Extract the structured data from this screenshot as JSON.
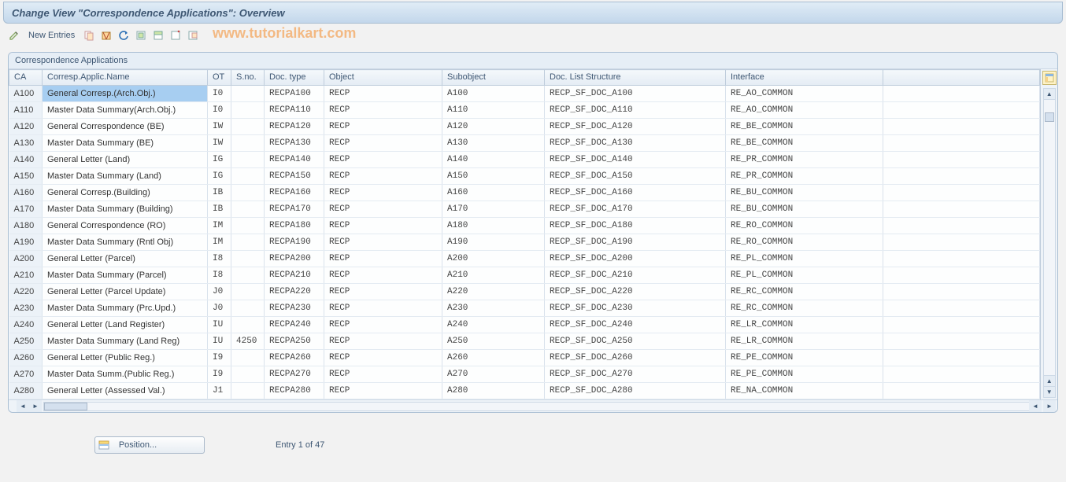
{
  "title": "Change View \"Correspondence Applications\": Overview",
  "toolbar": {
    "new_entries": "New Entries"
  },
  "watermark": "www.tutorialkart.com",
  "panel_title": "Correspondence Applications",
  "columns": {
    "ca": "CA",
    "name": "Corresp.Applic.Name",
    "ot": "OT",
    "sno": "S.no.",
    "doctype": "Doc. type",
    "object": "Object",
    "subobject": "Subobject",
    "dls": "Doc. List Structure",
    "interface": "Interface"
  },
  "rows": [
    {
      "ca": "A100",
      "name": "General Corresp.(Arch.Obj.)",
      "ot": "I0",
      "sno": "",
      "doctype": "RECPA100",
      "object": "RECP",
      "subobject": "A100",
      "dls": "RECP_SF_DOC_A100",
      "interface": "RE_AO_COMMON"
    },
    {
      "ca": "A110",
      "name": "Master Data Summary(Arch.Obj.)",
      "ot": "I0",
      "sno": "",
      "doctype": "RECPA110",
      "object": "RECP",
      "subobject": "A110",
      "dls": "RECP_SF_DOC_A110",
      "interface": "RE_AO_COMMON"
    },
    {
      "ca": "A120",
      "name": "General Correspondence (BE)",
      "ot": "IW",
      "sno": "",
      "doctype": "RECPA120",
      "object": "RECP",
      "subobject": "A120",
      "dls": "RECP_SF_DOC_A120",
      "interface": "RE_BE_COMMON"
    },
    {
      "ca": "A130",
      "name": "Master Data Summary (BE)",
      "ot": "IW",
      "sno": "",
      "doctype": "RECPA130",
      "object": "RECP",
      "subobject": "A130",
      "dls": "RECP_SF_DOC_A130",
      "interface": "RE_BE_COMMON"
    },
    {
      "ca": "A140",
      "name": "General Letter (Land)",
      "ot": "IG",
      "sno": "",
      "doctype": "RECPA140",
      "object": "RECP",
      "subobject": "A140",
      "dls": "RECP_SF_DOC_A140",
      "interface": "RE_PR_COMMON"
    },
    {
      "ca": "A150",
      "name": "Master Data Summary (Land)",
      "ot": "IG",
      "sno": "",
      "doctype": "RECPA150",
      "object": "RECP",
      "subobject": "A150",
      "dls": "RECP_SF_DOC_A150",
      "interface": "RE_PR_COMMON"
    },
    {
      "ca": "A160",
      "name": "General Corresp.(Building)",
      "ot": "IB",
      "sno": "",
      "doctype": "RECPA160",
      "object": "RECP",
      "subobject": "A160",
      "dls": "RECP_SF_DOC_A160",
      "interface": "RE_BU_COMMON"
    },
    {
      "ca": "A170",
      "name": "Master Data Summary (Building)",
      "ot": "IB",
      "sno": "",
      "doctype": "RECPA170",
      "object": "RECP",
      "subobject": "A170",
      "dls": "RECP_SF_DOC_A170",
      "interface": "RE_BU_COMMON"
    },
    {
      "ca": "A180",
      "name": "General Correspondence (RO)",
      "ot": "IM",
      "sno": "",
      "doctype": "RECPA180",
      "object": "RECP",
      "subobject": "A180",
      "dls": "RECP_SF_DOC_A180",
      "interface": "RE_RO_COMMON"
    },
    {
      "ca": "A190",
      "name": "Master Data Summary (Rntl Obj)",
      "ot": "IM",
      "sno": "",
      "doctype": "RECPA190",
      "object": "RECP",
      "subobject": "A190",
      "dls": "RECP_SF_DOC_A190",
      "interface": "RE_RO_COMMON"
    },
    {
      "ca": "A200",
      "name": "General Letter (Parcel)",
      "ot": "I8",
      "sno": "",
      "doctype": "RECPA200",
      "object": "RECP",
      "subobject": "A200",
      "dls": "RECP_SF_DOC_A200",
      "interface": "RE_PL_COMMON"
    },
    {
      "ca": "A210",
      "name": "Master Data Summary (Parcel)",
      "ot": "I8",
      "sno": "",
      "doctype": "RECPA210",
      "object": "RECP",
      "subobject": "A210",
      "dls": "RECP_SF_DOC_A210",
      "interface": "RE_PL_COMMON"
    },
    {
      "ca": "A220",
      "name": "General Letter (Parcel Update)",
      "ot": "J0",
      "sno": "",
      "doctype": "RECPA220",
      "object": "RECP",
      "subobject": "A220",
      "dls": "RECP_SF_DOC_A220",
      "interface": "RE_RC_COMMON"
    },
    {
      "ca": "A230",
      "name": "Master Data Summary (Prc.Upd.)",
      "ot": "J0",
      "sno": "",
      "doctype": "RECPA230",
      "object": "RECP",
      "subobject": "A230",
      "dls": "RECP_SF_DOC_A230",
      "interface": "RE_RC_COMMON"
    },
    {
      "ca": "A240",
      "name": "General Letter (Land Register)",
      "ot": "IU",
      "sno": "",
      "doctype": "RECPA240",
      "object": "RECP",
      "subobject": "A240",
      "dls": "RECP_SF_DOC_A240",
      "interface": "RE_LR_COMMON"
    },
    {
      "ca": "A250",
      "name": "Master Data Summary (Land Reg)",
      "ot": "IU",
      "sno": "4250",
      "doctype": "RECPA250",
      "object": "RECP",
      "subobject": "A250",
      "dls": "RECP_SF_DOC_A250",
      "interface": "RE_LR_COMMON"
    },
    {
      "ca": "A260",
      "name": "General Letter (Public Reg.)",
      "ot": "I9",
      "sno": "",
      "doctype": "RECPA260",
      "object": "RECP",
      "subobject": "A260",
      "dls": "RECP_SF_DOC_A260",
      "interface": "RE_PE_COMMON"
    },
    {
      "ca": "A270",
      "name": "Master Data Summ.(Public Reg.)",
      "ot": "I9",
      "sno": "",
      "doctype": "RECPA270",
      "object": "RECP",
      "subobject": "A270",
      "dls": "RECP_SF_DOC_A270",
      "interface": "RE_PE_COMMON"
    },
    {
      "ca": "A280",
      "name": "General Letter (Assessed Val.)",
      "ot": "J1",
      "sno": "",
      "doctype": "RECPA280",
      "object": "RECP",
      "subobject": "A280",
      "dls": "RECP_SF_DOC_A280",
      "interface": "RE_NA_COMMON"
    }
  ],
  "footer": {
    "position_button": "Position...",
    "entry_text": "Entry 1 of 47"
  }
}
